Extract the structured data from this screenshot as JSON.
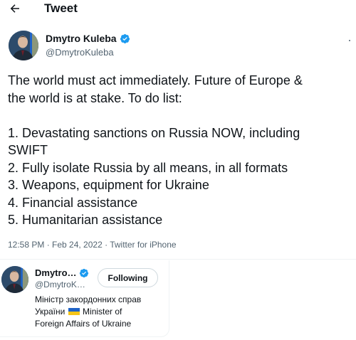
{
  "header": {
    "title": "Tweet",
    "back_icon": "arrow-left-icon"
  },
  "author": {
    "name": "Dmytro Kuleba",
    "handle": "@DmytroKuleba",
    "verified": true,
    "verified_color": "#1d9bf0"
  },
  "tweet": {
    "lines": [
      "The world must act immediately. Future of Europe &",
      "the world is at stake. To do list:",
      "",
      "1. Devastating sanctions on Russia NOW, including",
      "SWIFT",
      "2. Fully isolate Russia by all means, in all formats",
      "3. Weapons, equipment for Ukraine",
      "4. Financial assistance",
      "5. Humanitarian assistance"
    ],
    "meta": "12:58 PM · Feb 24, 2022 · Twitter for iPhone"
  },
  "hover_card": {
    "name": "Dmytro…",
    "handle": "@DmytroK…",
    "follow_label": "Following",
    "bio_line1": "Міністр закордонних справ",
    "bio_line2_pre": "України",
    "bio_line2_post": "Minister of",
    "bio_line3": "Foreign Affairs of Ukraine",
    "flag_colors": [
      "#1f63c7",
      "#f5c518"
    ]
  }
}
